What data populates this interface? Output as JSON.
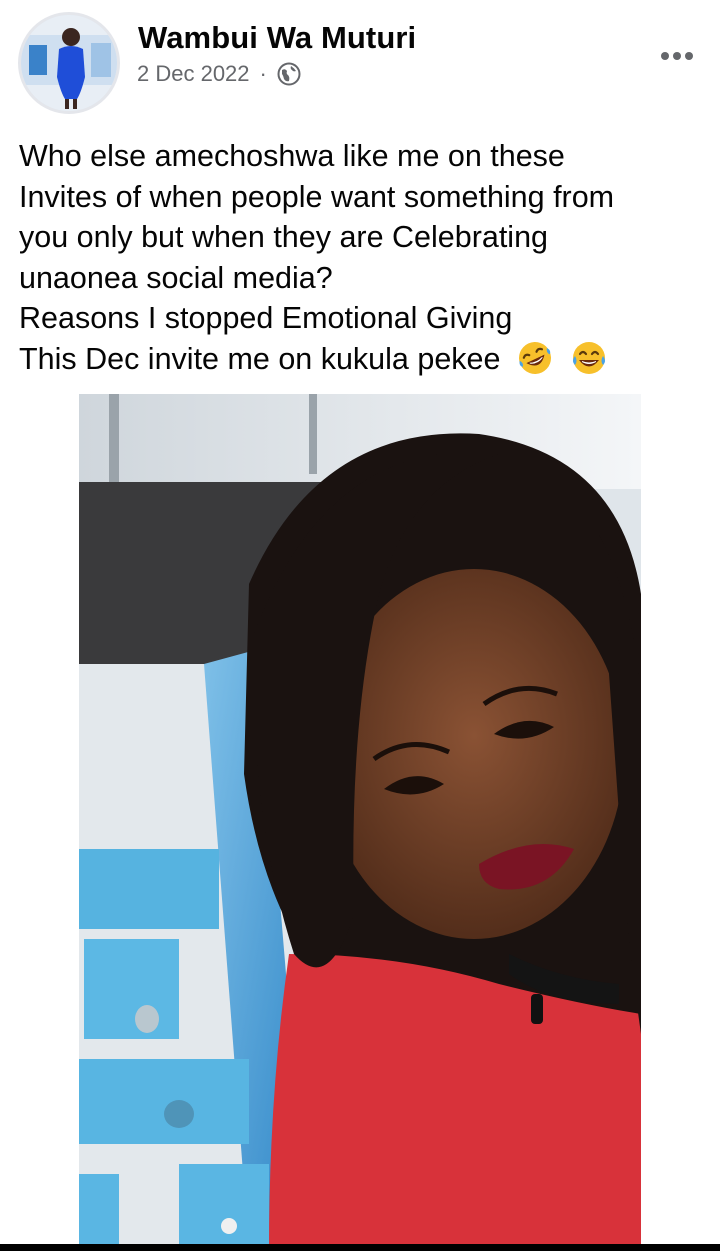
{
  "post": {
    "author": "Wambui Wa Muturi",
    "date": "2 Dec 2022",
    "separator": "·",
    "privacy_icon": "globe-icon",
    "more_icon": "more-options-icon",
    "text_lines": [
      "Who else amechoshwa like me on these",
      "Invites of when people want something from",
      "you only but when they are Celebrating",
      "unaonea social media?",
      "Reasons I stopped Emotional Giving",
      "This Dec invite me on kukula pekee"
    ],
    "emojis": [
      "rofl-emoji",
      "tears-of-joy-emoji"
    ]
  },
  "colors": {
    "text": "#050505",
    "secondary": "#65676b",
    "background": "#ffffff"
  }
}
